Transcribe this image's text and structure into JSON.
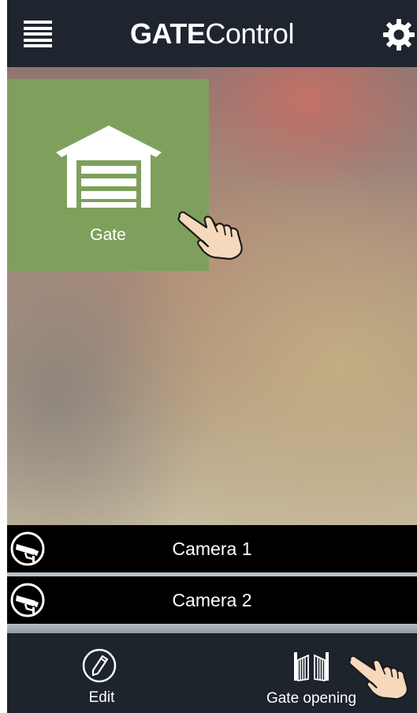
{
  "header": {
    "title_bold": "GATE",
    "title_light": "Control",
    "menu_icon": "hamburger-menu-icon",
    "settings_icon": "gear-icon"
  },
  "tiles": [
    {
      "label": "Gate",
      "icon": "garage-icon",
      "color": "#7fa05c"
    }
  ],
  "cameras": [
    {
      "label": "Camera 1",
      "icon": "security-camera-icon"
    },
    {
      "label": "Camera 2",
      "icon": "security-camera-icon"
    }
  ],
  "bottom_bar": {
    "edit_label": "Edit",
    "edit_icon": "pencil-icon",
    "gate_label": "Gate opening",
    "gate_icon": "gate-icon"
  },
  "colors": {
    "header_bg": "#1f252e",
    "tile_green": "#7fa05c",
    "camera_bar": "#000000"
  }
}
